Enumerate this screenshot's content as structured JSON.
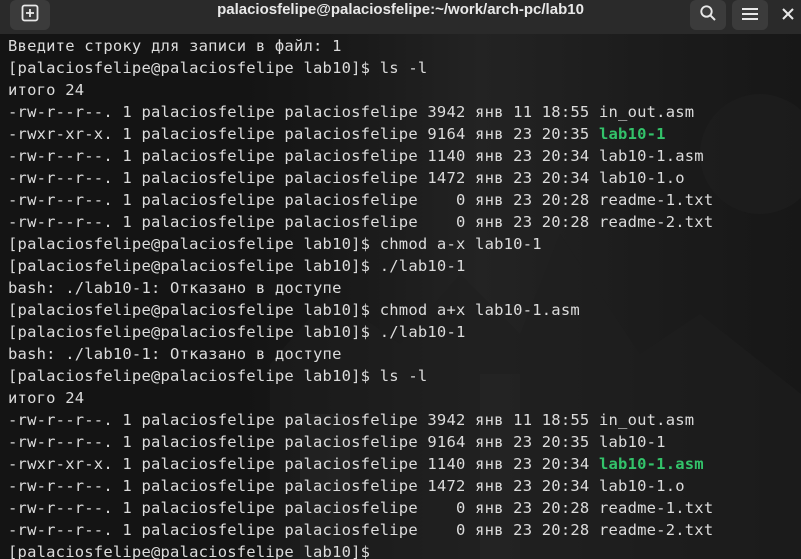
{
  "window": {
    "title": "palaciosfelipe@palaciosfelipe:~/work/arch-pc/lab10"
  },
  "icons": {
    "new_tab": "plus-box-icon",
    "search": "search-icon",
    "menu": "hamburger-menu-icon",
    "close": "close-icon"
  },
  "terminal": {
    "lines": [
      {
        "text": "Введите строку для записи в файл: 1"
      },
      {
        "text": "[palaciosfelipe@palaciosfelipe lab10]$ ls -l"
      },
      {
        "text": "итого 24"
      },
      {
        "prefix": "-rw-r--r--. 1 palaciosfelipe palaciosfelipe 3942 янв 11 18:55 ",
        "name": "in_out.asm",
        "exec": false
      },
      {
        "prefix": "-rwxr-xr-x. 1 palaciosfelipe palaciosfelipe 9164 янв 23 20:35 ",
        "name": "lab10-1",
        "exec": true
      },
      {
        "prefix": "-rw-r--r--. 1 palaciosfelipe palaciosfelipe 1140 янв 23 20:34 ",
        "name": "lab10-1.asm",
        "exec": false
      },
      {
        "prefix": "-rw-r--r--. 1 palaciosfelipe palaciosfelipe 1472 янв 23 20:34 ",
        "name": "lab10-1.o",
        "exec": false
      },
      {
        "prefix": "-rw-r--r--. 1 palaciosfelipe palaciosfelipe    0 янв 23 20:28 ",
        "name": "readme-1.txt",
        "exec": false
      },
      {
        "prefix": "-rw-r--r--. 1 palaciosfelipe palaciosfelipe    0 янв 23 20:28 ",
        "name": "readme-2.txt",
        "exec": false
      },
      {
        "text": "[palaciosfelipe@palaciosfelipe lab10]$ chmod a-x lab10-1"
      },
      {
        "text": "[palaciosfelipe@palaciosfelipe lab10]$ ./lab10-1"
      },
      {
        "text": "bash: ./lab10-1: Отказано в доступе"
      },
      {
        "text": "[palaciosfelipe@palaciosfelipe lab10]$ chmod a+x lab10-1.asm"
      },
      {
        "text": "[palaciosfelipe@palaciosfelipe lab10]$ ./lab10-1"
      },
      {
        "text": "bash: ./lab10-1: Отказано в доступе"
      },
      {
        "text": "[palaciosfelipe@palaciosfelipe lab10]$ ls -l"
      },
      {
        "text": "итого 24"
      },
      {
        "prefix": "-rw-r--r--. 1 palaciosfelipe palaciosfelipe 3942 янв 11 18:55 ",
        "name": "in_out.asm",
        "exec": false
      },
      {
        "prefix": "-rw-r--r--. 1 palaciosfelipe palaciosfelipe 9164 янв 23 20:35 ",
        "name": "lab10-1",
        "exec": false
      },
      {
        "prefix": "-rwxr-xr-x. 1 palaciosfelipe palaciosfelipe 1140 янв 23 20:34 ",
        "name": "lab10-1.asm",
        "exec": true
      },
      {
        "prefix": "-rw-r--r--. 1 palaciosfelipe palaciosfelipe 1472 янв 23 20:34 ",
        "name": "lab10-1.o",
        "exec": false
      },
      {
        "prefix": "-rw-r--r--. 1 palaciosfelipe palaciosfelipe    0 янв 23 20:28 ",
        "name": "readme-1.txt",
        "exec": false
      },
      {
        "prefix": "-rw-r--r--. 1 palaciosfelipe palaciosfelipe    0 янв 23 20:28 ",
        "name": "readme-2.txt",
        "exec": false
      },
      {
        "text": "[palaciosfelipe@palaciosfelipe lab10]$ "
      }
    ]
  },
  "colors": {
    "text": "#dcdcdc",
    "executable": "#33c36a",
    "titlebar": "#2a2a2a",
    "background": "#141414"
  }
}
